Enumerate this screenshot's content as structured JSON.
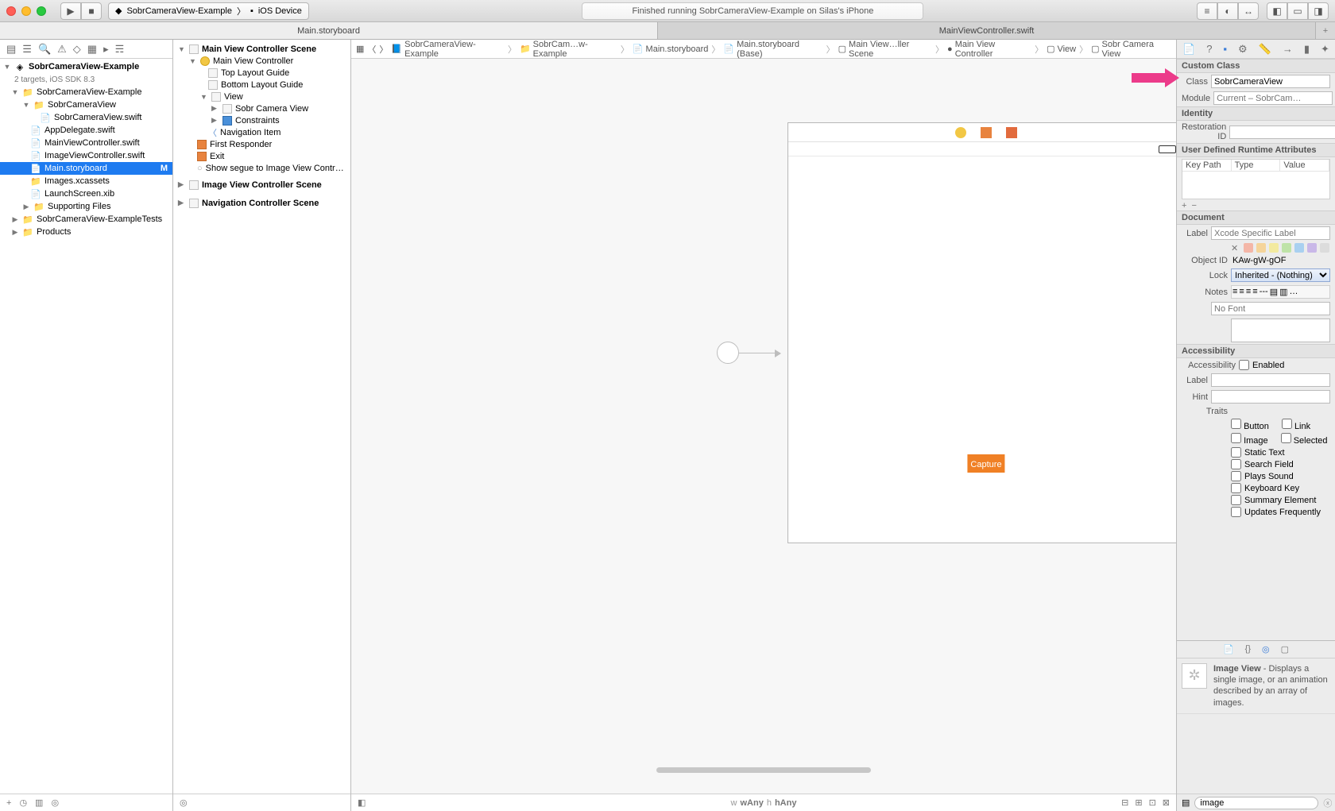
{
  "toolbar": {
    "scheme_target": "SobrCameraView-Example",
    "scheme_device": "iOS Device",
    "status": "Finished running SobrCameraView-Example on Silas's iPhone"
  },
  "tabs": {
    "left": "Main.storyboard",
    "right": "MainViewController.swift"
  },
  "navigator": {
    "project": "SobrCameraView-Example",
    "targets": "2 targets, iOS SDK 8.3",
    "g_root": "SobrCameraView-Example",
    "g_sobr": "SobrCameraView",
    "f_sobrswift": "SobrCameraView.swift",
    "f_appdel": "AppDelegate.swift",
    "f_mainvc": "MainViewController.swift",
    "f_imgvc": "ImageViewController.swift",
    "f_story": "Main.storyboard",
    "badge_m": "M",
    "f_assets": "Images.xcassets",
    "f_launch": "LaunchScreen.xib",
    "g_support": "Supporting Files",
    "g_tests": "SobrCameraView-ExampleTests",
    "g_products": "Products"
  },
  "outline": {
    "s1": "Main View Controller Scene",
    "mvc": "Main View Controller",
    "top": "Top Layout Guide",
    "bot": "Bottom Layout Guide",
    "view": "View",
    "sobr": "Sobr Camera View",
    "cons": "Constraints",
    "navi": "Navigation Item",
    "first": "First Responder",
    "exit": "Exit",
    "segue": "Show segue to Image View Contr…",
    "s2": "Image View Controller Scene",
    "s3": "Navigation Controller Scene"
  },
  "jump": {
    "a": "SobrCameraView-Example",
    "b": "SobrCam…w-Example",
    "c": "Main.storyboard",
    "d": "Main.storyboard (Base)",
    "e": "Main View…ller Scene",
    "f": "Main View Controller",
    "g": "View",
    "h": "Sobr Camera View"
  },
  "canvas": {
    "capture": "Capture",
    "sizeclass_w": "wAny",
    "sizeclass_h": "hAny"
  },
  "insp": {
    "custom_class": "Custom Class",
    "class_lbl": "Class",
    "class_val": "SobrCameraView",
    "module_lbl": "Module",
    "module_ph": "Current – SobrCam…",
    "identity": "Identity",
    "restid": "Restoration ID",
    "udra": "User Defined Runtime Attributes",
    "kp": "Key Path",
    "ty": "Type",
    "vl": "Value",
    "document": "Document",
    "label_lbl": "Label",
    "label_ph": "Xcode Specific Label",
    "objid_lbl": "Object ID",
    "objid_val": "KAw-gW-gOF",
    "lock_lbl": "Lock",
    "lock_val": "Inherited - (Nothing)",
    "notes_lbl": "Notes",
    "nofont": "No Font",
    "acc": "Accessibility",
    "acc_lbl": "Accessibility",
    "enabled": "Enabled",
    "a_label": "Label",
    "a_hint": "Hint",
    "a_traits": "Traits",
    "t_button": "Button",
    "t_link": "Link",
    "t_image": "Image",
    "t_selected": "Selected",
    "t_static": "Static Text",
    "t_search": "Search Field",
    "t_plays": "Plays Sound",
    "t_key": "Keyboard Key",
    "t_summary": "Summary Element",
    "t_updates": "Updates Frequently"
  },
  "library": {
    "title": "Image View",
    "desc": " - Displays a single image, or an animation described by an array of images.",
    "filter": "image"
  }
}
